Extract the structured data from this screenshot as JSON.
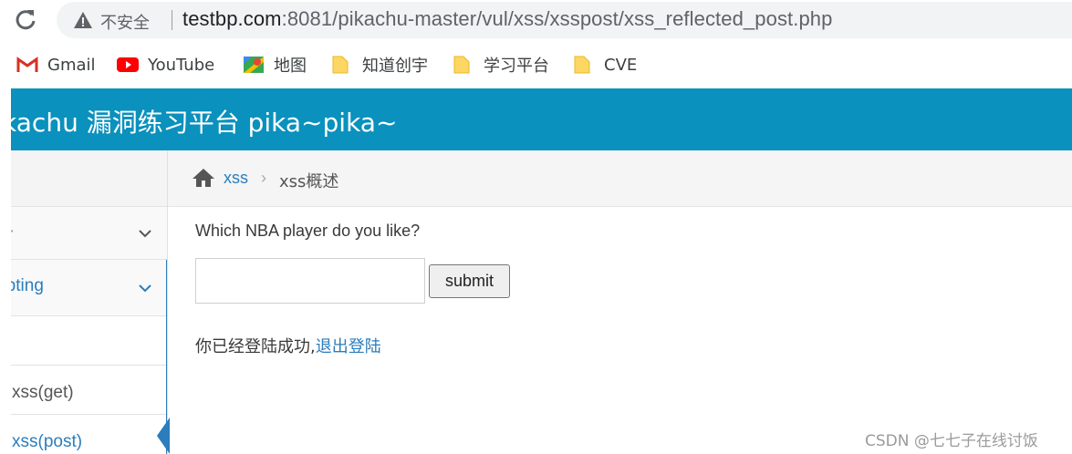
{
  "browser": {
    "security_label": "不安全",
    "url_host": "testbp.com",
    "url_rest": ":8081/pikachu-master/vul/xss/xsspost/xss_reflected_post.php"
  },
  "bookmarks": [
    {
      "label": "Gmail",
      "icon": "gmail-icon"
    },
    {
      "label": "YouTube",
      "icon": "youtube-icon"
    },
    {
      "label": "地图",
      "icon": "maps-icon"
    },
    {
      "label": "知道创宇",
      "icon": "folder-icon"
    },
    {
      "label": "学习平台",
      "icon": "folder-icon"
    },
    {
      "label": "CVE",
      "icon": "folder-icon"
    }
  ],
  "header": {
    "title": "Pikachu 漏洞练习平台 pika~pika~"
  },
  "sidebar": {
    "items": [
      {
        "label": "·"
      },
      {
        "label": "Cross-Site Scripting"
      },
      {
        "label": ""
      },
      {
        "label": "反射型xss(get)"
      },
      {
        "label": "反射性xss(post)"
      }
    ]
  },
  "breadcrumb": {
    "link": "xss",
    "separator": "›",
    "current": "xss概述"
  },
  "form": {
    "question": "Which NBA player do you like?",
    "input_value": "",
    "submit_label": "submit"
  },
  "status": {
    "text": "你已经登陆成功,",
    "logout": "退出登陆"
  },
  "watermark": "CSDN @七七子在线讨饭",
  "colors": {
    "header_bg": "#0a91bd",
    "link": "#2b7dbc"
  }
}
